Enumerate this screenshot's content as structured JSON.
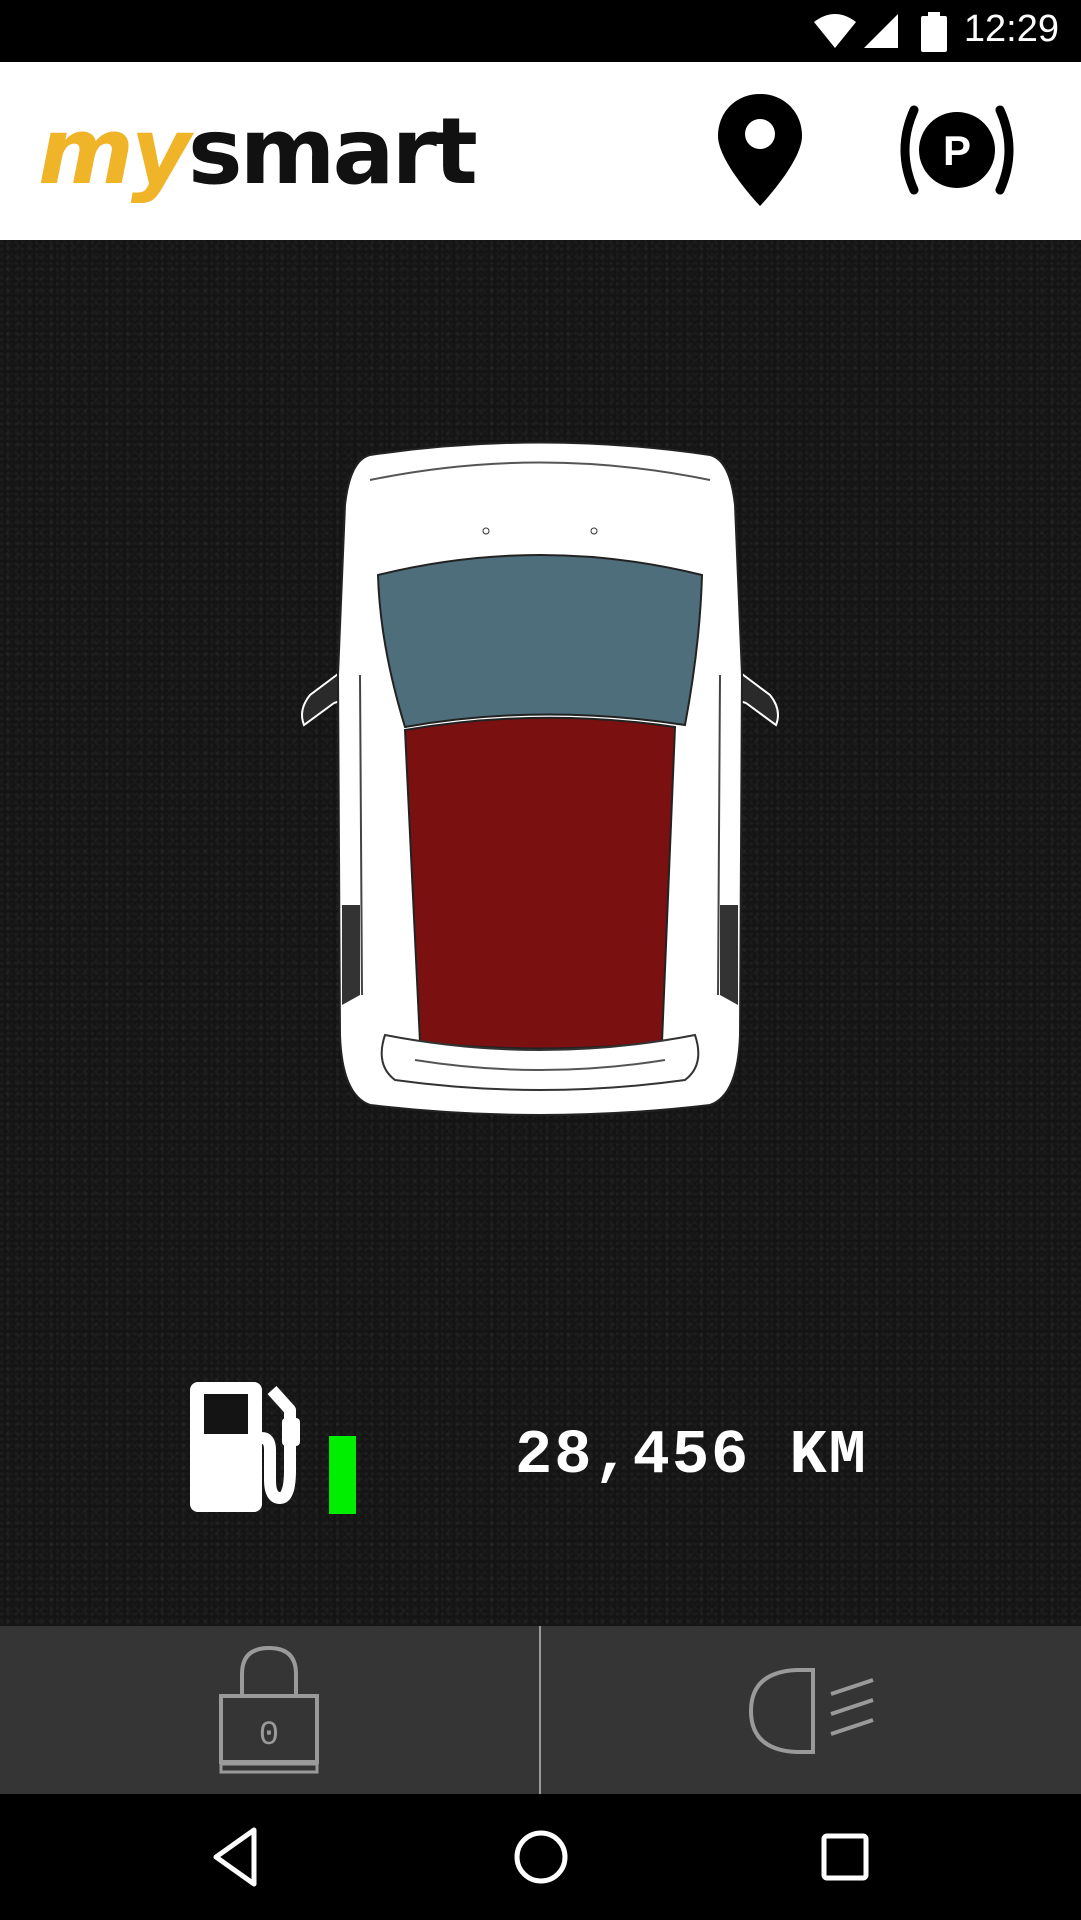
{
  "status_bar": {
    "time": "12:29",
    "icons": [
      "wifi-icon",
      "signal-icon",
      "battery-icon"
    ]
  },
  "header": {
    "logo_my": "my",
    "logo_smart": "smart",
    "logo_colors": {
      "my": "#f0b429",
      "smart": "#111111"
    },
    "actions": [
      "location-pin-icon",
      "parking-icon"
    ],
    "parking_letter": "P"
  },
  "vehicle": {
    "view": "top-down car illustration",
    "windshield_color": "#4f6e7c",
    "roof_color": "#7a1010",
    "body_color": "#ffffff"
  },
  "fuel": {
    "icon": "fuel-pump-icon",
    "level_color": "#00ee00"
  },
  "odometer": {
    "text": "28,456 KM"
  },
  "actions": {
    "lock_icon": "lock-icon",
    "lock_number": "0",
    "lights_icon": "headlight-icon"
  },
  "nav": [
    "back-icon",
    "home-icon",
    "recents-icon"
  ]
}
